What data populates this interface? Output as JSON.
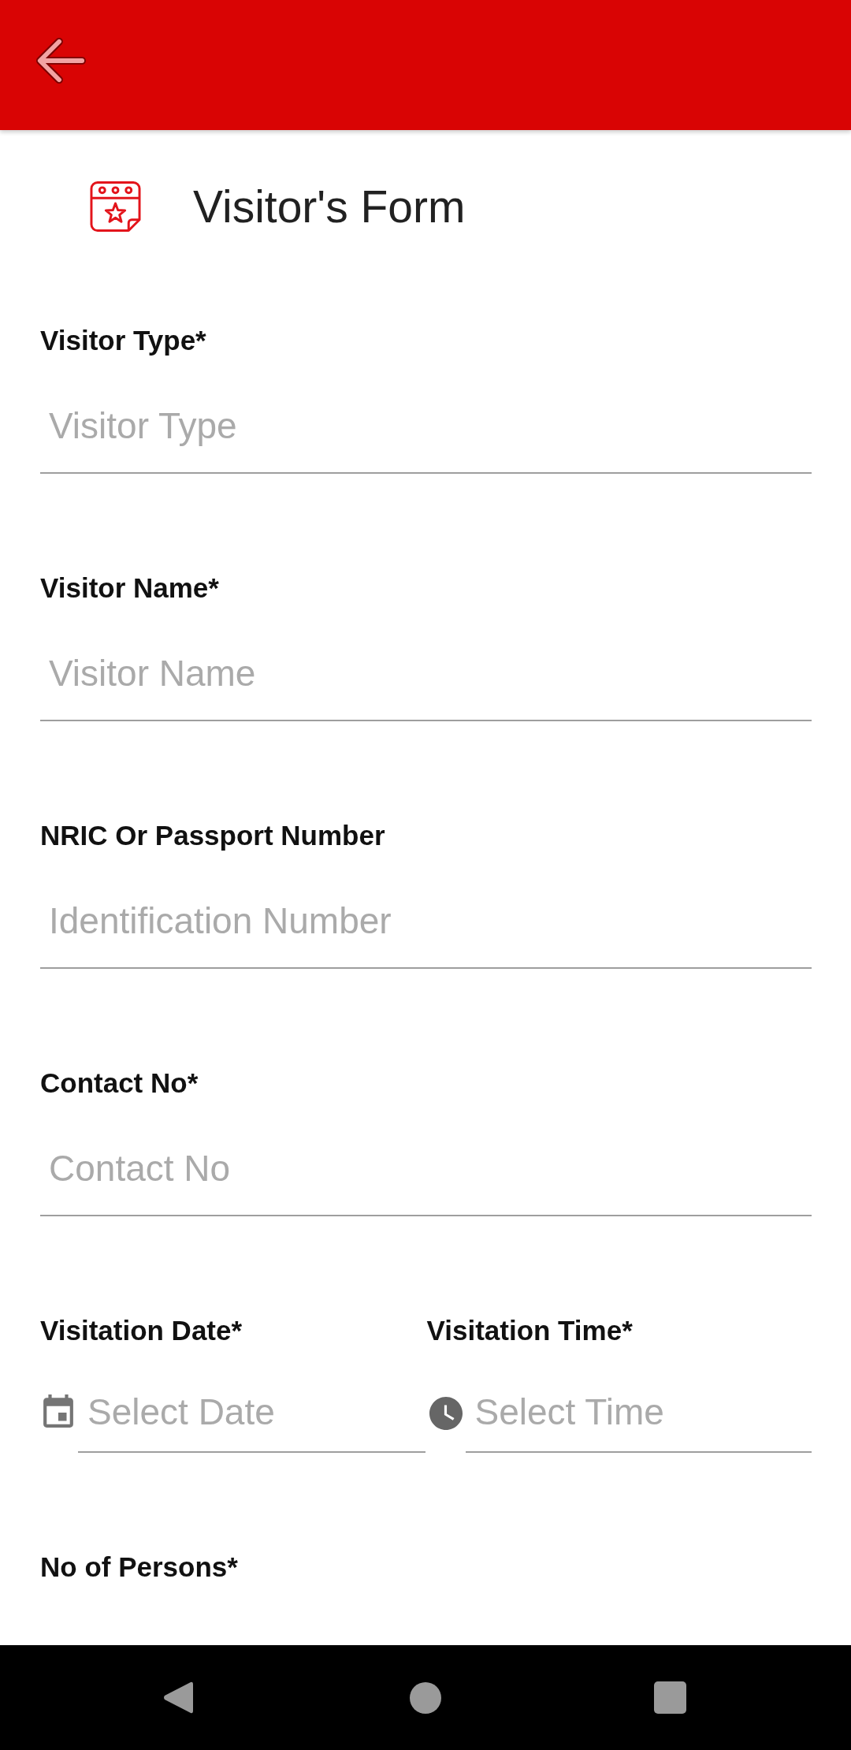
{
  "header": {
    "title": "Visitor's Form"
  },
  "fields": [
    {
      "label": "Visitor Type*",
      "placeholder": "Visitor Type"
    },
    {
      "label": "Visitor Name*",
      "placeholder": "Visitor Name"
    },
    {
      "label": "NRIC Or Passport Number",
      "placeholder": "Identification Number"
    },
    {
      "label": "Contact No*",
      "placeholder": "Contact No"
    }
  ],
  "schedule_fields": [
    {
      "kind": "date",
      "label": "Visitation Date*",
      "placeholder": "Select Date"
    },
    {
      "kind": "time",
      "label": "Visitation Time*",
      "placeholder": "Select Time"
    }
  ],
  "persons_field": {
    "label": "No of Persons*"
  }
}
